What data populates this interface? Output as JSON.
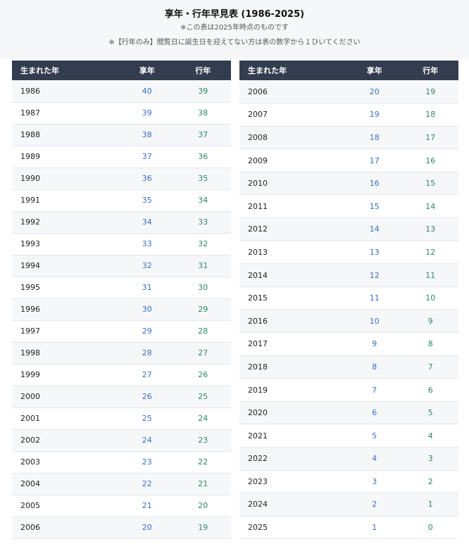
{
  "header": {
    "title": "享年・行年早見表 (1986-2025)",
    "note1": "※この表は2025年時点のものです",
    "note2": "※【行年のみ】閲覧日に誕生日を迎えてない方は表の数字から１ひいてください"
  },
  "columns": {
    "year": "生まれた年",
    "kyonen": "享年",
    "gyonen": "行年"
  },
  "colors": {
    "header_bg": "#343d4f",
    "kyonen_text": "#3a6fc6",
    "gyonen_text": "#2a8a5a"
  },
  "left_rows": [
    {
      "year": "1986",
      "kyonen": "40",
      "gyonen": "39"
    },
    {
      "year": "1987",
      "kyonen": "39",
      "gyonen": "38"
    },
    {
      "year": "1988",
      "kyonen": "38",
      "gyonen": "37"
    },
    {
      "year": "1989",
      "kyonen": "37",
      "gyonen": "36"
    },
    {
      "year": "1990",
      "kyonen": "36",
      "gyonen": "35"
    },
    {
      "year": "1991",
      "kyonen": "35",
      "gyonen": "34"
    },
    {
      "year": "1992",
      "kyonen": "34",
      "gyonen": "33"
    },
    {
      "year": "1993",
      "kyonen": "33",
      "gyonen": "32"
    },
    {
      "year": "1994",
      "kyonen": "32",
      "gyonen": "31"
    },
    {
      "year": "1995",
      "kyonen": "31",
      "gyonen": "30"
    },
    {
      "year": "1996",
      "kyonen": "30",
      "gyonen": "29"
    },
    {
      "year": "1997",
      "kyonen": "29",
      "gyonen": "28"
    },
    {
      "year": "1998",
      "kyonen": "28",
      "gyonen": "27"
    },
    {
      "year": "1999",
      "kyonen": "27",
      "gyonen": "26"
    },
    {
      "year": "2000",
      "kyonen": "26",
      "gyonen": "25"
    },
    {
      "year": "2001",
      "kyonen": "25",
      "gyonen": "24"
    },
    {
      "year": "2002",
      "kyonen": "24",
      "gyonen": "23"
    },
    {
      "year": "2003",
      "kyonen": "23",
      "gyonen": "22"
    },
    {
      "year": "2004",
      "kyonen": "22",
      "gyonen": "21"
    },
    {
      "year": "2005",
      "kyonen": "21",
      "gyonen": "20"
    },
    {
      "year": "2006",
      "kyonen": "20",
      "gyonen": "19"
    }
  ],
  "right_rows": [
    {
      "year": "2006",
      "kyonen": "20",
      "gyonen": "19"
    },
    {
      "year": "2007",
      "kyonen": "19",
      "gyonen": "18"
    },
    {
      "year": "2008",
      "kyonen": "18",
      "gyonen": "17"
    },
    {
      "year": "2009",
      "kyonen": "17",
      "gyonen": "16"
    },
    {
      "year": "2010",
      "kyonen": "16",
      "gyonen": "15"
    },
    {
      "year": "2011",
      "kyonen": "15",
      "gyonen": "14"
    },
    {
      "year": "2012",
      "kyonen": "14",
      "gyonen": "13"
    },
    {
      "year": "2013",
      "kyonen": "13",
      "gyonen": "12"
    },
    {
      "year": "2014",
      "kyonen": "12",
      "gyonen": "11"
    },
    {
      "year": "2015",
      "kyonen": "11",
      "gyonen": "10"
    },
    {
      "year": "2016",
      "kyonen": "10",
      "gyonen": "9"
    },
    {
      "year": "2017",
      "kyonen": "9",
      "gyonen": "8"
    },
    {
      "year": "2018",
      "kyonen": "8",
      "gyonen": "7"
    },
    {
      "year": "2019",
      "kyonen": "7",
      "gyonen": "6"
    },
    {
      "year": "2020",
      "kyonen": "6",
      "gyonen": "5"
    },
    {
      "year": "2021",
      "kyonen": "5",
      "gyonen": "4"
    },
    {
      "year": "2022",
      "kyonen": "4",
      "gyonen": "3"
    },
    {
      "year": "2023",
      "kyonen": "3",
      "gyonen": "2"
    },
    {
      "year": "2024",
      "kyonen": "2",
      "gyonen": "1"
    },
    {
      "year": "2025",
      "kyonen": "1",
      "gyonen": "0"
    }
  ]
}
